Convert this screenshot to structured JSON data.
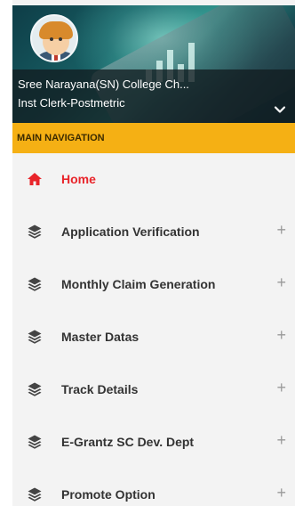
{
  "profile": {
    "name": "Sree Narayana(SN) College Ch...",
    "role": "Inst Clerk-Postmetric",
    "toggle_icon": "chevron-down-icon"
  },
  "nav": {
    "header": "MAIN NAVIGATION",
    "items": [
      {
        "label": "Home",
        "icon": "home-icon",
        "active": true,
        "expandable": false
      },
      {
        "label": "Application Verification",
        "icon": "layers-icon",
        "active": false,
        "expandable": true,
        "expand_symbol": "+"
      },
      {
        "label": "Monthly Claim Generation",
        "icon": "layers-icon",
        "active": false,
        "expandable": true,
        "expand_symbol": "+"
      },
      {
        "label": "Master Datas",
        "icon": "layers-icon",
        "active": false,
        "expandable": true,
        "expand_symbol": "+"
      },
      {
        "label": "Track Details",
        "icon": "layers-icon",
        "active": false,
        "expandable": true,
        "expand_symbol": "+"
      },
      {
        "label": "E-Grantz SC Dev. Dept",
        "icon": "layers-icon",
        "active": false,
        "expandable": true,
        "expand_symbol": "+"
      },
      {
        "label": "Promote Option",
        "icon": "layers-icon",
        "active": false,
        "expandable": true,
        "expand_symbol": "+"
      }
    ]
  },
  "colors": {
    "accent": "#f5b014",
    "active": "#e8242a",
    "text": "#333333",
    "sidebar_bg": "#f3f3f3"
  }
}
